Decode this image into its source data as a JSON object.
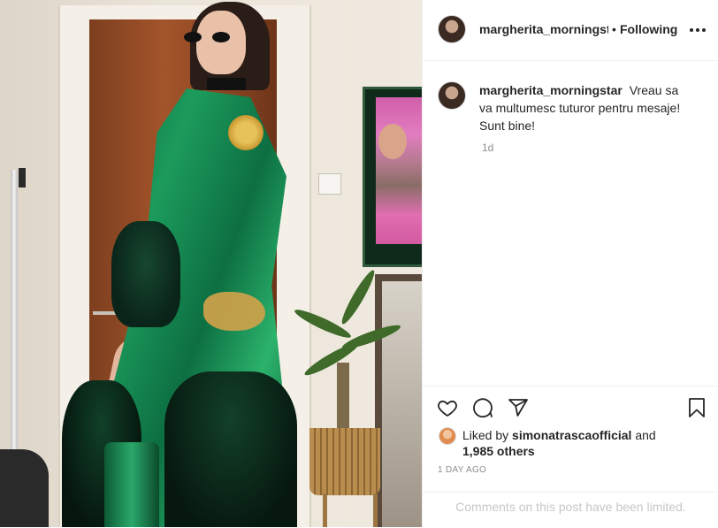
{
  "post": {
    "username": "margherita_morningstar",
    "header_separator": "•",
    "follow_state": "Following",
    "more_icon": "more-horizontal-icon",
    "caption": {
      "username": "margherita_morningstar",
      "text": "Vreau sa va multumesc tuturor pentru mesaje! Sunt bine!",
      "age": "1d"
    },
    "actions": {
      "like_icon": "heart-icon",
      "comment_icon": "comment-icon",
      "share_icon": "share-icon",
      "save_icon": "bookmark-icon"
    },
    "likes": {
      "prefix": "Liked by",
      "user": "simonatrascaofficial",
      "conjunction": "and",
      "others": "1,985 others"
    },
    "date": "1 DAY AGO",
    "comments_notice": "Comments on this post have been limited."
  },
  "colors": {
    "text": "#262626",
    "secondary": "#8e8e8e",
    "muted": "#c7c7c7",
    "border": "#efefef"
  }
}
